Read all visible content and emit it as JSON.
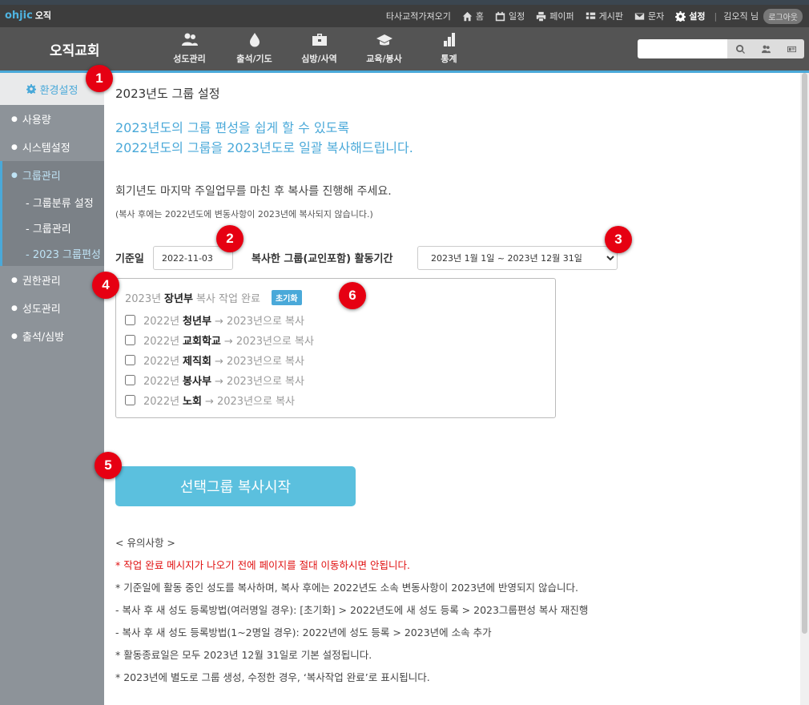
{
  "brand": {
    "logo": "ohjic",
    "name": "오직"
  },
  "toplinks": [
    {
      "label": "타사교적가져오기",
      "icon": ""
    },
    {
      "label": "홈",
      "icon": "home-icon"
    },
    {
      "label": "일정",
      "icon": "calendar-icon"
    },
    {
      "label": "페이퍼",
      "icon": "print-icon"
    },
    {
      "label": "게시판",
      "icon": "list-icon"
    },
    {
      "label": "문자",
      "icon": "mail-icon"
    },
    {
      "label": "설정",
      "icon": "gear-icon"
    }
  ],
  "user": {
    "name": "김오직 님",
    "logout": "로그아웃"
  },
  "church_name": "오직교회",
  "nav": [
    {
      "label": "성도관리",
      "icon": "users-icon"
    },
    {
      "label": "출석/기도",
      "icon": "drop-icon"
    },
    {
      "label": "심방/사역",
      "icon": "briefcase-icon"
    },
    {
      "label": "교육/봉사",
      "icon": "graduation-cap-icon"
    },
    {
      "label": "통계",
      "icon": "bar-chart-icon"
    }
  ],
  "search": {
    "value": ""
  },
  "sidebar": {
    "setting": "환경설정",
    "items_top": [
      "사용량",
      "시스템설정"
    ],
    "group": {
      "label": "그룹관리",
      "subs": [
        "- 그룹분류 설정",
        "- 그룹관리",
        "- 2023 그룹편성"
      ]
    },
    "items_bottom": [
      "권한관리",
      "성도관리",
      "출석/심방"
    ]
  },
  "page": {
    "title": "2023년도 그룹 설정",
    "intro1": "2023년도의 그룹 편성을 쉽게 할 수 있도록",
    "intro2": "2022년도의 그룹을 2023년도로 일괄 복사해드립니다.",
    "note1": "회기년도 마지막 주일업무를 마친 후 복사를 진행해 주세요.",
    "note2": "(복사 후에는 2022년도에 변동사항이 2023년에 복사되지 않습니다.)",
    "base_date_label": "기준일",
    "base_date": "2022-11-03",
    "period_label": "복사한 그룹(교인포함) 활동기간",
    "period_value": "2023년 1월 1일 ~ 2023년 12월 31일"
  },
  "done": {
    "year": "2023년",
    "group": "장년부",
    "status": "복사 작업 완료",
    "reset": "초기화"
  },
  "groups": [
    {
      "year": "2022년",
      "name": "청년부",
      "suffix": "→ 2023년으로 복사"
    },
    {
      "year": "2022년",
      "name": "교회학교",
      "suffix": "→ 2023년으로 복사"
    },
    {
      "year": "2022년",
      "name": "제직회",
      "suffix": "→ 2023년으로 복사"
    },
    {
      "year": "2022년",
      "name": "봉사부",
      "suffix": "→ 2023년으로 복사"
    },
    {
      "year": "2022년",
      "name": "노회",
      "suffix": "→ 2023년으로 복사"
    }
  ],
  "copy_button": "선택그룹 복사시작",
  "cautions": {
    "title": "< 유의사항 >",
    "warn": "* 작업 완료 메시지가 나오기 전에 페이지를 절대 이동하시면 안됩니다.",
    "items": [
      "* 기준일에 활동 중인 성도를 복사하며, 복사 후에는 2022년도 소속 변동사항이 2023년에 반영되지 않습니다.",
      "- 복사 후 새 성도 등록방법(여러명일 경우): [초기화] > 2022년도에 새 성도 등록 > 2023그룹편성 복사 재진행",
      "- 복사 후 새 성도 등록방법(1~2명일 경우): 2022년에 성도 등록 > 2023년에 소속 추가",
      "* 활동종료일은 모두 2023년 12월 31일로 기본 설정됩니다.",
      "* 2023년에 별도로 그룹 생성, 수정한 경우, ‘복사작업 완료’로 표시됩니다."
    ]
  },
  "badges": [
    "1",
    "2",
    "3",
    "4",
    "5",
    "6"
  ],
  "colors": {
    "accent": "#4aa9d9",
    "badge": "#e60012",
    "warn": "#e01010",
    "button": "#5bc0de"
  }
}
